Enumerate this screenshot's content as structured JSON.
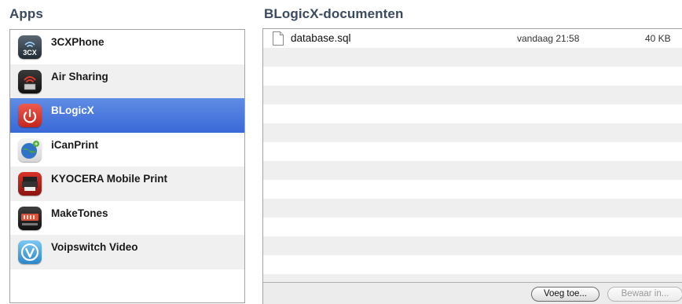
{
  "sections": {
    "apps_title": "Apps",
    "documents_title": "BLogicX-documenten"
  },
  "apps": [
    {
      "name": "3CXPhone",
      "icon": "3cxphone-app-icon",
      "selected": false
    },
    {
      "name": "Air Sharing",
      "icon": "air-sharing-app-icon",
      "selected": false
    },
    {
      "name": "BLogicX",
      "icon": "blogicx-app-icon",
      "selected": true
    },
    {
      "name": "iCanPrint",
      "icon": "icanprint-app-icon",
      "selected": false
    },
    {
      "name": "KYOCERA Mobile Print",
      "icon": "kyocera-mobile-print-app-icon",
      "selected": false
    },
    {
      "name": "MakeTones",
      "icon": "maketones-app-icon",
      "selected": false
    },
    {
      "name": "Voipswitch Video",
      "icon": "voipswitch-video-app-icon",
      "selected": false
    }
  ],
  "documents": [
    {
      "name": "database.sql",
      "date": "vandaag 21:58",
      "size": "40 KB",
      "icon": "document-icon"
    }
  ],
  "buttons": {
    "add_label": "Voeg toe...",
    "save_label": "Bewaar in..."
  },
  "colors": {
    "selection": "#3a69d8",
    "section_title": "#3b4a5e",
    "stripe": "#efefef"
  }
}
